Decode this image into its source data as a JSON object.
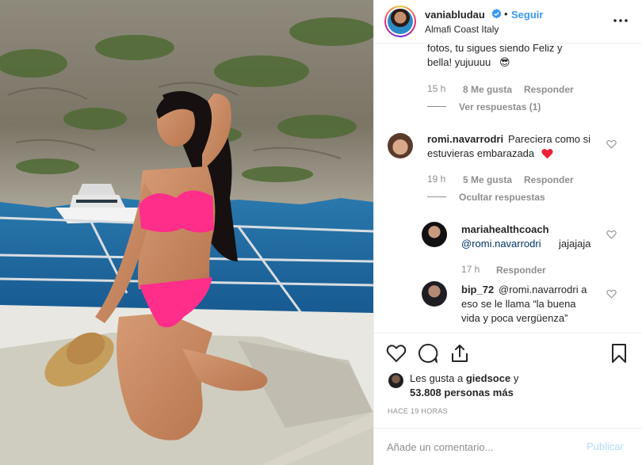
{
  "header": {
    "username": "vaniabludau",
    "separator": "•",
    "follow_label": "Seguir",
    "location": "Almafi Coast Italy"
  },
  "icons": {
    "verified": "verified-badge-icon",
    "more": "more-options-icon",
    "like": "heart-icon",
    "comment": "comment-icon",
    "share": "share-icon",
    "save": "bookmark-icon"
  },
  "colors": {
    "accent": "#3897f0",
    "muted": "#8e8e8e",
    "text": "#262626",
    "red_heart": "#ed2139",
    "bikini": "#ff2e8a"
  },
  "comments": [
    {
      "text_line1": "fotos, tu sigues siendo Feliz y",
      "text_line2": "bella! yujuuuu",
      "emoji": "😎",
      "time": "15 h",
      "likes": "8 Me gusta",
      "reply": "Responder",
      "replies_toggle": "Ver respuestas (1)"
    },
    {
      "username": "romi.navarrodri",
      "text_line1": "Pareciera como si",
      "text_line2": "estuvieras embarazada",
      "time": "19 h",
      "likes": "5 Me gusta",
      "reply": "Responder",
      "replies_toggle": "Ocultar respuestas"
    }
  ],
  "replies": [
    {
      "username": "mariahealthcoach",
      "mention": "@romi.navarrodri",
      "text": "jajajaja",
      "time": "17 h",
      "reply": "Responder"
    },
    {
      "username": "bip_72",
      "text_line1": "@romi.navarrodri a",
      "text_line2": "eso se le llama “la buena",
      "text_line3": "vida y poca vergüenza”"
    }
  ],
  "likes": {
    "prefix": "Les gusta a",
    "user": "giedsoce",
    "suffix": "y",
    "count_text": "53.808 personas más"
  },
  "time_ago": "HACE 19 HORAS",
  "add_comment": {
    "placeholder": "Añade un comentario...",
    "publish_label": "Publicar"
  }
}
